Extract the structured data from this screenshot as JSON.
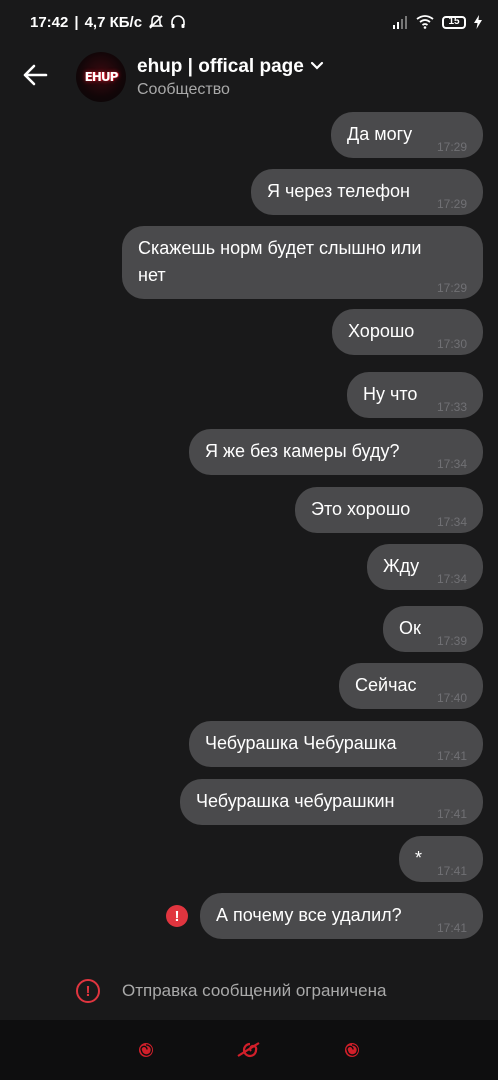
{
  "status_bar": {
    "time": "17:42",
    "speed": "4,7 КБ/с",
    "battery": "15"
  },
  "header": {
    "back_icon": "arrow-left-icon",
    "avatar_text": "EHUP",
    "title": "ehup | offical page",
    "subtitle": "Сообщество",
    "dropdown_icon": "chevron-down-icon"
  },
  "messages": [
    {
      "text": "Да могу",
      "time": "17:29"
    },
    {
      "text": "Я через телефон",
      "time": "17:29"
    },
    {
      "text": "Скажешь норм будет слышно  или\nнет",
      "time": "17:29"
    },
    {
      "text": "Хорошо",
      "time": "17:30"
    },
    {
      "text": "Ну что",
      "time": "17:33"
    },
    {
      "text": "Я же без камеры буду?",
      "time": "17:34"
    },
    {
      "text": "Это хорошо",
      "time": "17:34"
    },
    {
      "text": "Жду",
      "time": "17:34"
    },
    {
      "text": "Ок",
      "time": "17:39"
    },
    {
      "text": "Сейчас",
      "time": "17:40"
    },
    {
      "text": "Чебурашка Чебурашка",
      "time": "17:41"
    },
    {
      "text": "Чебурашка чебурашкин",
      "time": "17:41"
    },
    {
      "text": "*",
      "time": "17:41"
    },
    {
      "text": "А почему все удалил?",
      "time": "17:41",
      "failed": true
    }
  ],
  "restriction": {
    "text": "Отправка сообщений ограничена",
    "icon": "alert-circle-icon"
  },
  "bottom_nav": {
    "icons": [
      "swirl-icon",
      "leaf-village-icon",
      "swirl-icon"
    ]
  },
  "colors": {
    "background": "#19191a",
    "bubble": "#4a4a4c",
    "accent_red": "#e0353f",
    "nav_red": "#d11f2a"
  }
}
